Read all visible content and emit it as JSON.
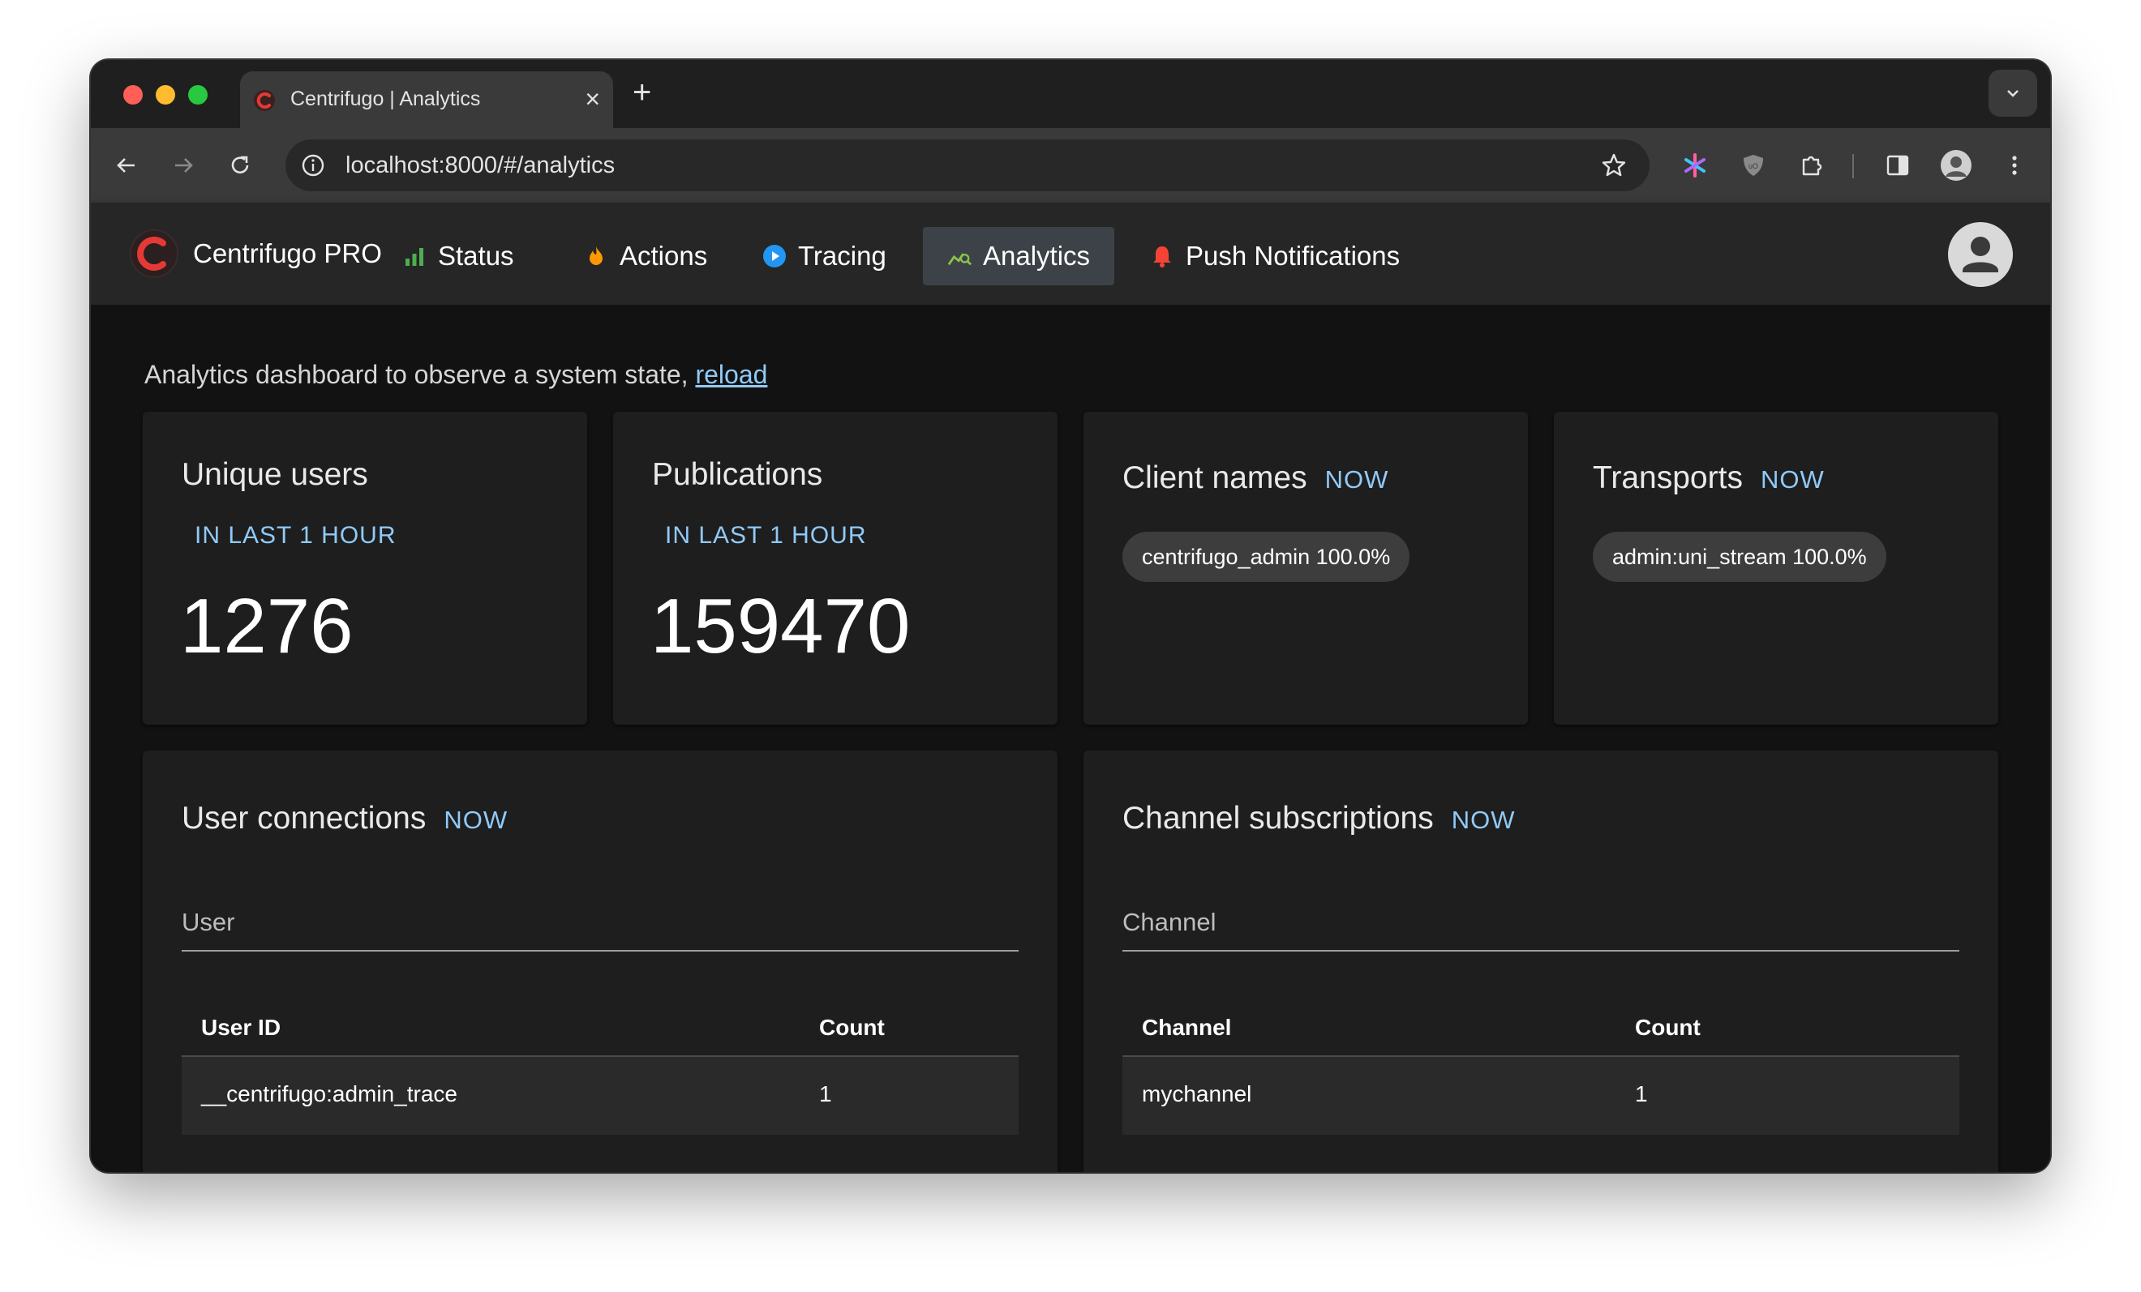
{
  "browser": {
    "tab_title": "Centrifugo | Analytics",
    "url": "localhost:8000/#/analytics"
  },
  "nav": {
    "brand": "Centrifugo PRO",
    "items": [
      {
        "label": "Status",
        "icon": "bar-chart-icon",
        "color": "#4caf50"
      },
      {
        "label": "Actions",
        "icon": "fire-icon",
        "color": "#ff9800"
      },
      {
        "label": "Tracing",
        "icon": "play-circle-icon",
        "color": "#2196f3"
      },
      {
        "label": "Analytics",
        "icon": "analytics-icon",
        "color": "#8bc34a",
        "active": true
      },
      {
        "label": "Push Notifications",
        "icon": "bell-icon",
        "color": "#f44336"
      }
    ]
  },
  "page": {
    "intro_text": "Analytics dashboard to observe a system state, ",
    "reload_link": "reload"
  },
  "cards": {
    "unique_users": {
      "title": "Unique users",
      "subtitle": "IN LAST 1 HOUR",
      "value": "1276"
    },
    "publications": {
      "title": "Publications",
      "subtitle": "IN LAST 1 HOUR",
      "value": "159470"
    },
    "client_names": {
      "title": "Client names",
      "badge": "NOW",
      "chips": [
        "centrifugo_admin 100.0%"
      ]
    },
    "transports": {
      "title": "Transports",
      "badge": "NOW",
      "chips": [
        "admin:uni_stream 100.0%"
      ]
    }
  },
  "user_connections": {
    "title": "User connections",
    "badge": "NOW",
    "filter_label": "User",
    "columns": [
      "User ID",
      "Count"
    ],
    "rows": [
      [
        "__centrifugo:admin_trace",
        "1"
      ]
    ]
  },
  "channel_subscriptions": {
    "title": "Channel subscriptions",
    "badge": "NOW",
    "filter_label": "Channel",
    "columns": [
      "Channel",
      "Count"
    ],
    "rows": [
      [
        "mychannel",
        "1"
      ]
    ]
  },
  "colors": {
    "accent": "#90caf9",
    "brand": "#e53935"
  }
}
